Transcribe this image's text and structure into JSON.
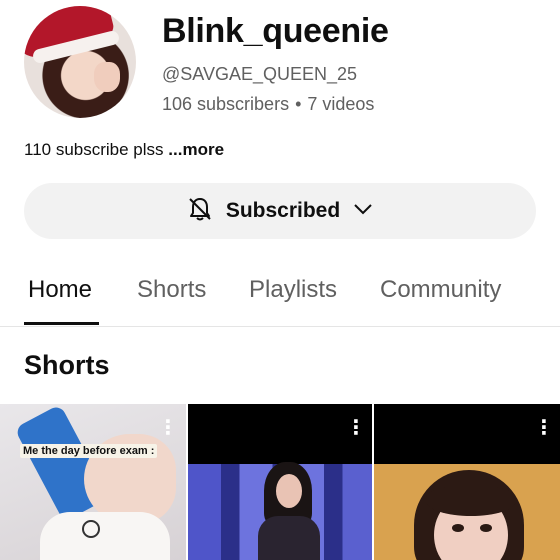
{
  "channel": {
    "name": "Blink_queenie",
    "handle": "@SAVGAE_QUEEN_25",
    "subscribers": "106 subscribers",
    "separator": "•",
    "videos": "7 videos",
    "description": "110 subscribe plss",
    "more_label": "...more"
  },
  "subscribe_button": {
    "label": "Subscribed",
    "bell_icon": "bell-off-icon",
    "chevron_icon": "chevron-down-icon"
  },
  "tabs": [
    {
      "label": "Home",
      "active": true
    },
    {
      "label": "Shorts",
      "active": false
    },
    {
      "label": "Playlists",
      "active": false
    },
    {
      "label": "Community",
      "active": false
    }
  ],
  "shorts_section": {
    "title": "Shorts",
    "items": [
      {
        "caption": "Me the day before exam :",
        "menu_icon": "kebab-menu-icon"
      },
      {
        "caption": "",
        "menu_icon": "kebab-menu-icon"
      },
      {
        "caption": "",
        "menu_icon": "kebab-menu-icon"
      }
    ]
  },
  "colors": {
    "text_primary": "#0f0f0f",
    "text_secondary": "#606060",
    "button_bg": "#f2f2f2"
  }
}
